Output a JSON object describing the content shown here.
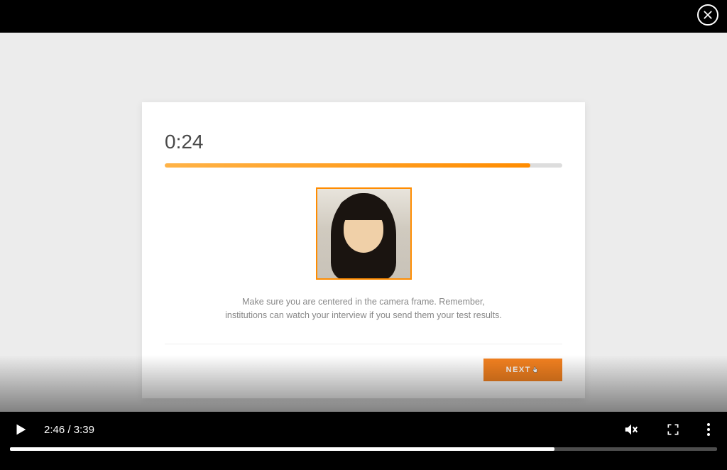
{
  "card": {
    "timer": "0:24",
    "progress_percent": 92,
    "instruction": "Make sure you are centered in the camera frame. Remember, institutions can watch your interview if you send them your test results.",
    "next_label": "NEXT"
  },
  "player": {
    "current_time": "2:46",
    "duration": "3:39",
    "time_separator": " / ",
    "progress_percent": 77
  }
}
